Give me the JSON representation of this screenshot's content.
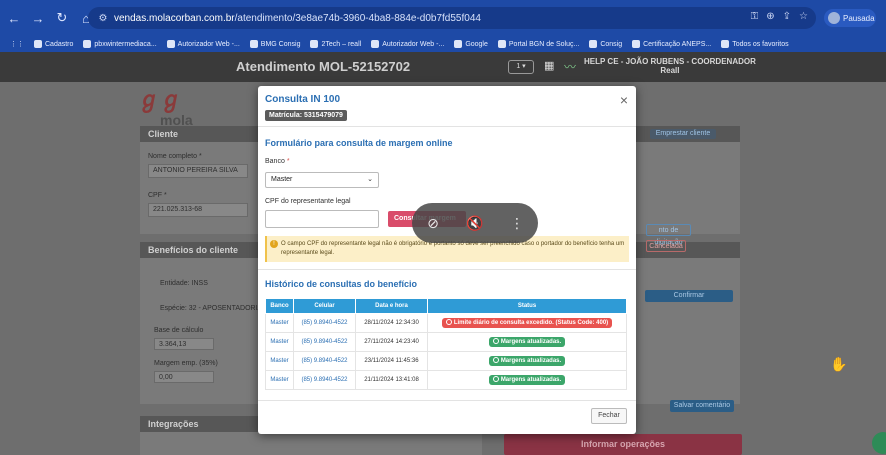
{
  "browser": {
    "url_host": "vendas.molacorban.com.br",
    "url_path": "/atendimento/3e8ae74b-3960-4ba8-884e-d0b7fd55f044",
    "profile_label": "Pausada",
    "bookmarks": [
      "Cadastro",
      "pbxwintermediaca...",
      "Autorizador Web -...",
      "BMG Consig",
      "2Tech – reall",
      "Autorizador Web -...",
      "Google",
      "Portal BGN de Soluç...",
      "Consig",
      "Certificação ANEPS...",
      "Todos os favoritos"
    ]
  },
  "app": {
    "title": "Atendimento MOL-52152702",
    "logo_text": "mola",
    "header_badge": "1 ▾",
    "user_line1": "HELP CE - JOÃO RUBENS - COORDENADOR",
    "user_line2": "Reall"
  },
  "background": {
    "cliente_head": "Cliente",
    "nome_label": "Nome completo *",
    "nome_value": "ANTONIO PEREIRA SILVA",
    "cpf_label": "CPF *",
    "cpf_value": "221.025.313-68",
    "beneficios_head": "Benefícios do cliente",
    "entidade": "Entidade: INSS",
    "especie": "Espécie: 32 - APOSENTADORIA",
    "base_calculo_label": "Base de cálculo",
    "base_calculo_value": "3.364,13",
    "margem_label": "Margem emp. (35%)",
    "margem_value": "0,00",
    "integracoes_head": "Integrações",
    "confirmar": "Confirmar",
    "salvar_comentario": "Salvar comentário",
    "informar_operacoes": "Informar operações",
    "cancelada": "Cancelada",
    "enviar_digitacao": "nto de digitação",
    "empresar_cliente": "Emprestar cliente"
  },
  "modal": {
    "title": "Consulta IN 100",
    "matricula": "Matrícula: 5315479079",
    "form_title": "Formulário para consulta de margem online",
    "banco_label": "Banco",
    "banco_value": "Master",
    "cpf_rep_label": "CPF do representante legal",
    "consult_button": "Consultar margem",
    "warning": "O campo CPF do representante legal não é obrigatório e portanto só deve ser preenchido caso o portador do benefício tenha um representante legal.",
    "history_title": "Histórico de consultas do benefício",
    "columns": [
      "Banco",
      "Celular",
      "Data e hora",
      "Status"
    ],
    "rows": [
      {
        "banco": "Master",
        "celular": "(85) 9.8940-4522",
        "data": "28/11/2024 12:34:30",
        "status": "Limite diário de consulta excedido. (Status Code: 400)",
        "status_type": "error"
      },
      {
        "banco": "Master",
        "celular": "(85) 9.8940-4522",
        "data": "27/11/2024 14:23:40",
        "status": "Margens atualizadas.",
        "status_type": "success"
      },
      {
        "banco": "Master",
        "celular": "(85) 9.8940-4522",
        "data": "23/11/2024 11:45:36",
        "status": "Margens atualizadas.",
        "status_type": "success"
      },
      {
        "banco": "Master",
        "celular": "(85) 9.8940-4522",
        "data": "21/11/2024 13:41:08",
        "status": "Margens atualizadas.",
        "status_type": "success"
      }
    ],
    "close_button": "Fechar"
  },
  "colors": {
    "error": "#e8534f",
    "success": "#3ca66a",
    "accent": "#2b6fb3",
    "table_header": "#2f9bd6"
  }
}
